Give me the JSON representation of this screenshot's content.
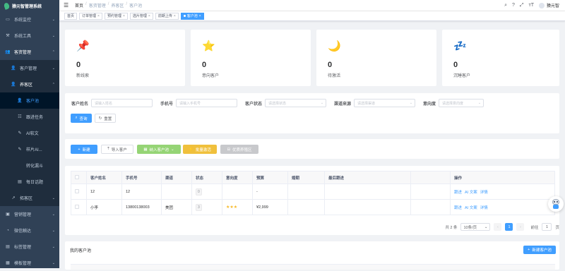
{
  "app": {
    "title": "猿元智管理系统"
  },
  "sidebar": {
    "items": [
      {
        "label": "系统监控",
        "icon": "monitor-icon"
      },
      {
        "label": "系统工具",
        "icon": "tool-icon"
      },
      {
        "label": "客资管理",
        "icon": "people-icon"
      },
      {
        "label": "客户管理",
        "icon": "user-icon"
      },
      {
        "label": "养客区",
        "icon": "user-icon"
      },
      {
        "label": "客户池",
        "icon": "user-icon"
      },
      {
        "label": "跟进任务",
        "icon": "list-icon"
      },
      {
        "label": "AI软文",
        "icon": "edit-icon"
      },
      {
        "label": "样片AI...",
        "icon": "edit-icon"
      },
      {
        "label": "转化漏斗",
        "icon": ""
      },
      {
        "label": "每日话题",
        "icon": "doc-icon"
      },
      {
        "label": "拓客区",
        "icon": "chart-icon"
      },
      {
        "label": "营销管理",
        "icon": "marketing-icon"
      },
      {
        "label": "微信触达",
        "icon": "wechat-icon"
      },
      {
        "label": "标签管理",
        "icon": "tag-icon"
      },
      {
        "label": "模板管理",
        "icon": "template-icon"
      }
    ]
  },
  "header": {
    "breadcrumb": [
      "首页",
      "客资管理",
      "养客区",
      "客户池"
    ],
    "user": "猿元智"
  },
  "tags": [
    "首页",
    "订单管理",
    "预约管理",
    "选片管理",
    "前期上传",
    "客户池"
  ],
  "stats": [
    {
      "icon": "pin-icon",
      "glyph": "📌",
      "value": "0",
      "label": "新线索"
    },
    {
      "icon": "star-icon",
      "glyph": "⭐",
      "value": "0",
      "label": "意向客户"
    },
    {
      "icon": "moon-icon",
      "glyph": "🌙",
      "value": "0",
      "label": "待激活"
    },
    {
      "icon": "sleep-icon",
      "glyph": "💤",
      "value": "0",
      "label": "沉睡客户"
    }
  ],
  "search": {
    "name_label": "客户姓名",
    "name_placeholder": "请输入姓名",
    "phone_label": "手机号",
    "phone_placeholder": "请输入手机号",
    "status_label": "客户状态",
    "status_placeholder": "请选择状态",
    "channel_label": "渠道来源",
    "channel_placeholder": "请选择渠道",
    "intent_label": "意向度",
    "intent_placeholder": "请选择意向度",
    "query": "查询",
    "reset": "重置"
  },
  "toolbar": {
    "add": "新建",
    "import": "导入客户",
    "join": "纳入客户池",
    "batch": "批量激活",
    "assign": "优质养殖区"
  },
  "table": {
    "headers": [
      "客户姓名",
      "手机号",
      "渠道",
      "状态",
      "意向度",
      "预算",
      "婚期",
      "最后跟进",
      "",
      "操作"
    ],
    "rows": [
      {
        "name": "12",
        "phone": "12",
        "channel": "",
        "status": "0",
        "stars": "",
        "budget": "-",
        "ops": [
          "跟进",
          "AI 文案",
          "详情"
        ]
      },
      {
        "name": "小李",
        "phone": "13800138003",
        "channel": "美团",
        "status": "3",
        "stars": "★★★",
        "budget": "¥2,999",
        "ops": [
          "跟进",
          "AI 文案",
          "详情"
        ]
      }
    ]
  },
  "pager": {
    "total": "共 2 条",
    "size": "10条/页",
    "page": "1",
    "goto": "前往",
    "goto_val": "1",
    "unit": "页"
  },
  "mypool": {
    "title": "我的客户池",
    "new_btn": "新建客户池"
  }
}
